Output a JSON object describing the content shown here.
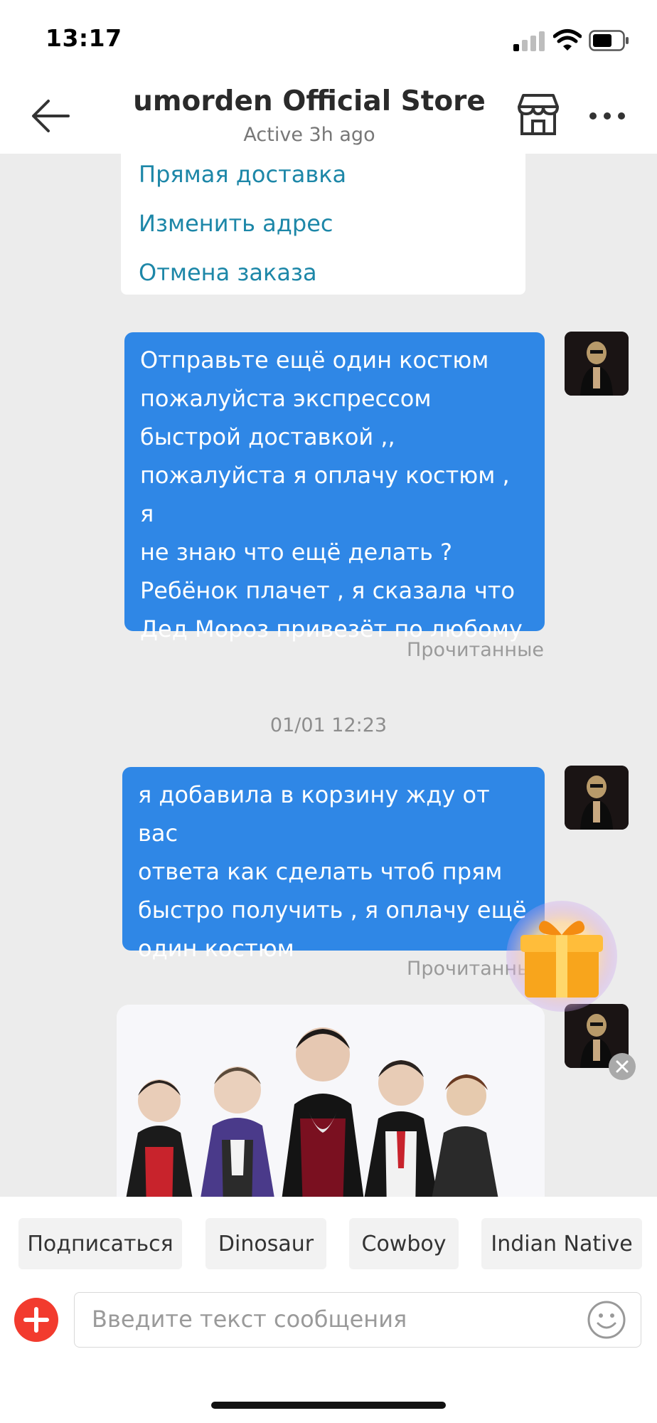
{
  "status_bar": {
    "time": "13:17"
  },
  "header": {
    "title": "umorden Official Store",
    "subtitle": "Active 3h ago"
  },
  "options_card": {
    "items": [
      "Прямая доставка",
      "Изменить адрес",
      "Отмена заказа"
    ]
  },
  "messages": [
    {
      "text": "Отправьте ещё один костюм\nпожалуйста экспрессом\nбыстрой доставкой ,,\nпожалуйста я оплачу костюм , я\nне знаю что ещё делать ?\nРебёнок плачет , я сказала что\nДед Мороз привезёт по любому",
      "status": "Прочитанные"
    },
    {
      "text": "я добавила в корзину жду от вас\nответа как сделать чтоб прям\nбыстро получить , я оплачу ещё\nодин костюм",
      "status": "Прочитанные"
    }
  ],
  "timestamp": "01/01 12:23",
  "chips": [
    "Подписаться",
    "Dinosaur",
    "Cowboy",
    "Indian Native"
  ],
  "input": {
    "placeholder": "Введите текст сообщения"
  },
  "colors": {
    "accent_blue": "#2f87e6",
    "link_teal": "#1d87a8",
    "chat_bg": "#ececec",
    "plus_red": "#f23b2e"
  },
  "icons": [
    "back-arrow-icon",
    "store-icon",
    "more-dots-icon",
    "plus-icon",
    "emoji-icon",
    "gift-icon",
    "close-icon",
    "signal-icon",
    "wifi-icon",
    "battery-icon"
  ]
}
